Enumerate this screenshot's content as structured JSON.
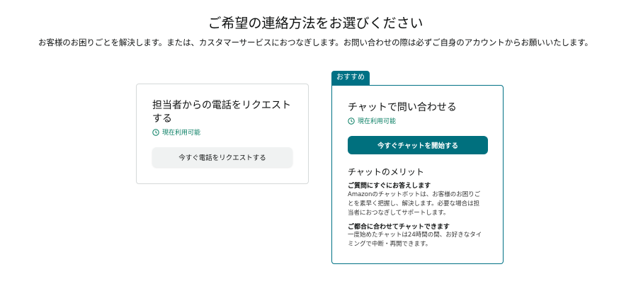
{
  "header": {
    "title": "ご希望の連絡方法をお選びください",
    "subtitle": "お客様のお困りごとを解決します。または、カスタマーサービスにおつなぎします。お問い合わせの際は必ずご自身のアカウントからお願いいたします。"
  },
  "call_card": {
    "title": "担当者からの電話をリクエストする",
    "status": "現在利用可能",
    "button_label": "今すぐ電話をリクエストする"
  },
  "chat_card": {
    "badge": "おすすめ",
    "title": "チャットで問い合わせる",
    "status": "現在利用可能",
    "button_label": "今すぐチャットを開始する",
    "benefits_title": "チャットのメリット",
    "benefits": [
      {
        "heading": "ご質問にすぐにお答えします",
        "body": "Amazonのチャットボットは、お客様のお困りごとを素早く把握し、解決します。必要な場合は担当者におつなぎしてサポートします。"
      },
      {
        "heading": "ご都合に合わせてチャットできます",
        "body": "一度始めたチャットは24時間の間、お好きなタイミングで中断・再開できます。"
      }
    ]
  },
  "colors": {
    "accent": "#007185",
    "chat_button": "#00707e",
    "available_green": "#067d62",
    "border": "#d5d9d9"
  },
  "icons": {
    "status": "clock-icon"
  }
}
